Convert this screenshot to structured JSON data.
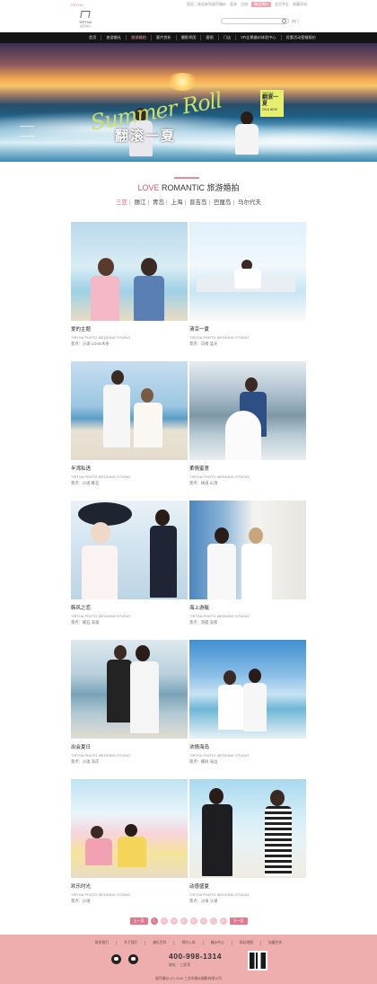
{
  "topbar": {
    "welcome": "TIRTHA",
    "links": [
      "您好，欢迎来到缇莎婚纱",
      "登录",
      "注册",
      "微信预约",
      "会员专区",
      "收藏本站"
    ]
  },
  "header": {
    "logo_text": "TIRTHA",
    "logo_sub": "缇莎婚纱",
    "search_placeholder": "",
    "search_extra": "热门"
  },
  "nav": {
    "items": [
      "首页",
      "旅游婚礼",
      "旅游婚拍",
      "客片赏析",
      "摄影师团",
      "客照",
      "门店",
      "VR全景婚纱体验中心",
      "优惠活动套餐报价"
    ],
    "active_index": 2
  },
  "banner": {
    "script": "Summer Roll",
    "cn": "翻滚一夏",
    "tag_line1": "TIRTHA",
    "tag_big": "翻滚一夏",
    "tag_line2": "2016 NEW"
  },
  "section": {
    "love": "LOVE",
    "romantic": "ROMANTIC",
    "cn": "旅游婚拍",
    "cities": [
      "三亚",
      "丽江",
      "青岛",
      "上海",
      "普吉岛",
      "巴厘岛",
      "马尔代夫"
    ],
    "active_city": 0
  },
  "cards": [
    {
      "title": "爱的主题",
      "studio": "TIRTHA PHOTO WEDDING STUDIO",
      "place": "景点：沙滩 LOVE木条"
    },
    {
      "title": "清凉一夏",
      "studio": "TIRTHA PHOTO WEDDING STUDIO",
      "place": "景点：白椅 蓝天"
    },
    {
      "title": "半湾私语",
      "studio": "TIRTHA PHOTO WEDDING STUDIO",
      "place": "景点：沙滩 礁石"
    },
    {
      "title": "柔情蜜意",
      "studio": "TIRTHA PHOTO WEDDING STUDIO",
      "place": "景点：栈道 山顶"
    },
    {
      "title": "韩风之恋",
      "studio": "TIRTHA PHOTO WEDDING STUDIO",
      "place": "景点：礁石 海滩"
    },
    {
      "title": "海上游艇",
      "studio": "TIRTHA PHOTO WEDDING STUDIO",
      "place": "景点：游艇 海景"
    },
    {
      "title": "出会夏日",
      "studio": "TIRTHA PHOTO WEDDING STUDIO",
      "place": "景点：沙滩 海岸"
    },
    {
      "title": "浓情海岛",
      "studio": "TIRTHA PHOTO WEDDING STUDIO",
      "place": "景点：椰树 海边"
    },
    {
      "title": "欢乐时光",
      "studio": "TIRTHA PHOTO WEDDING STUDIO",
      "place": "景点：沙滩"
    },
    {
      "title": "动感盛夏",
      "studio": "TIRTHA PHOTO WEDDING STUDIO",
      "place": "景点：沙滩 沙滩"
    }
  ],
  "pager": {
    "prev": "上一页",
    "next": "下一页",
    "pages": [
      "1",
      "2",
      "3",
      "4",
      "5",
      "6",
      "7",
      "8"
    ],
    "current": 0
  },
  "footer": {
    "links": [
      "联系我们",
      "关于我们",
      "婚礼百科",
      "预约入场",
      "婚纱中心",
      "网站地图",
      "加盟合作"
    ],
    "phone": "400-998-1314",
    "address": "地址：三亚湾",
    "copyright": "缇莎婚纱 (C) 2016 三亚市婚纱摄影有限公司"
  },
  "colors": {
    "accent": "#e07b8f",
    "nav_bg": "#141414",
    "footer_bg": "#eeaeae"
  }
}
